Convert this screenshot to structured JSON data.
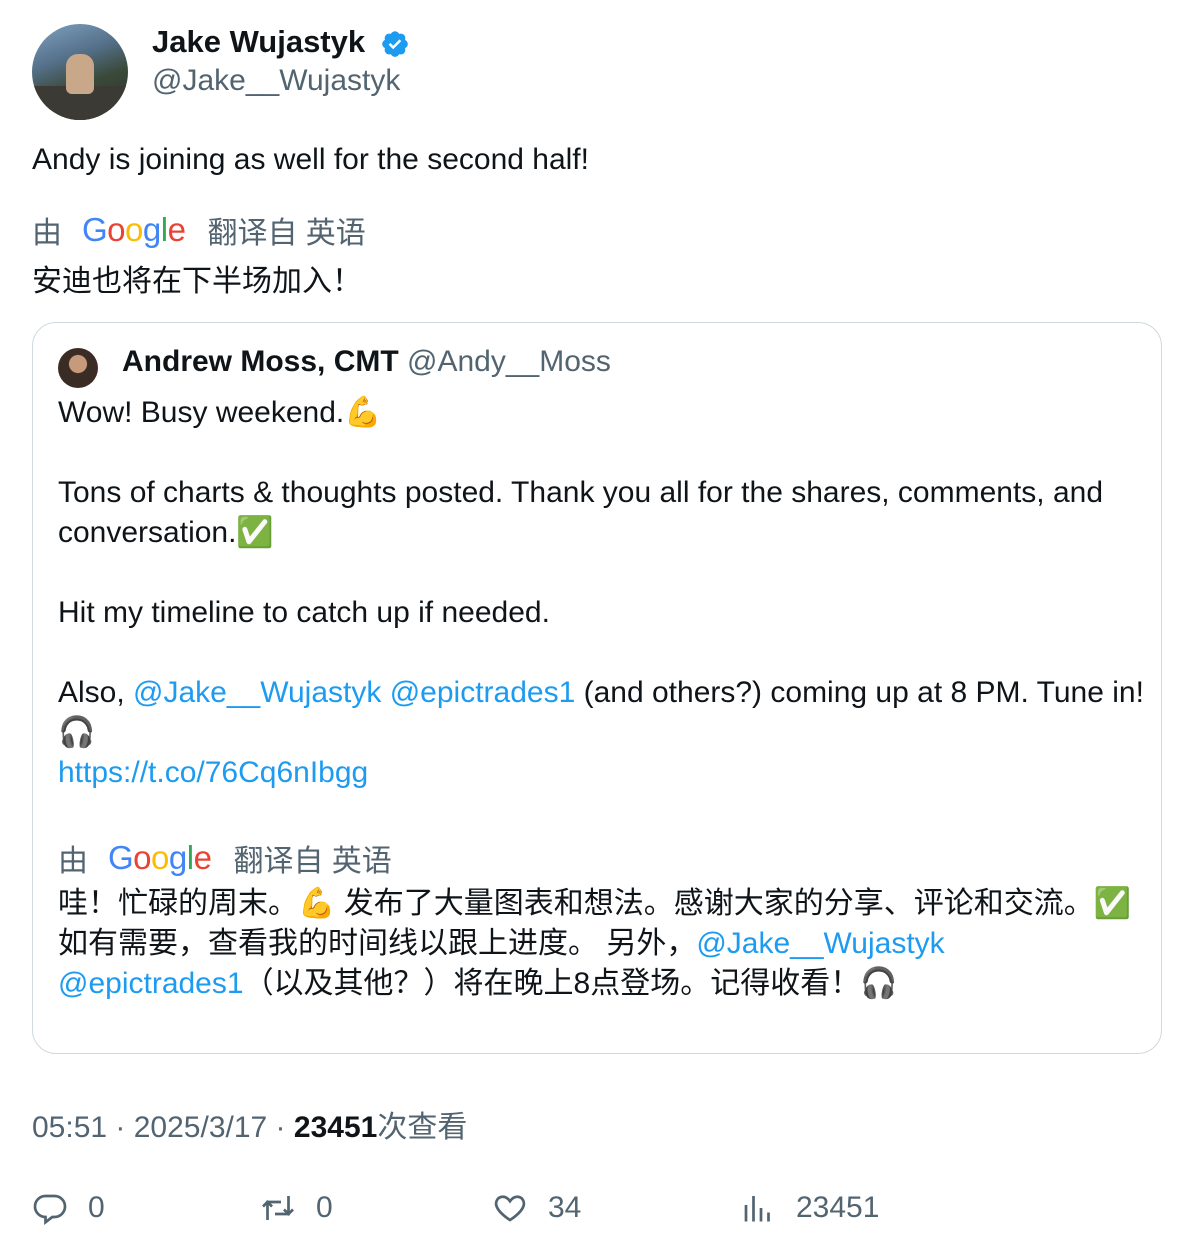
{
  "author": {
    "name": "Jake Wujastyk",
    "handle": "@Jake__Wujastyk"
  },
  "tweet_text": "Andy is joining as well for the second half!",
  "translation": {
    "by": "由",
    "translated_from": "翻译自 英语",
    "text": "安迪也将在下半场加入！"
  },
  "quoted": {
    "name": "Andrew Moss, CMT",
    "handle": "@Andy__Moss",
    "line1": "Wow! Busy weekend.💪",
    "line2": "Tons of charts & thoughts posted. Thank you all for the shares, comments, and conversation.✅",
    "line3": "Hit my timeline to catch up if needed.",
    "line4_prefix": "Also, ",
    "mention1": "@Jake__Wujastyk",
    "mention2": "@epictrades1",
    "line4_suffix": " (and others?) coming up at 8 PM. Tune in!🎧",
    "url": "https://t.co/76Cq6nIbgg",
    "translation_by": "由",
    "translation_from": "翻译自 英语",
    "translation_part1": "哇！忙碌的周末。💪 发布了大量图表和想法。感谢大家的分享、评论和交流。✅ 如有需要，查看我的时间线以跟上进度。 另外，",
    "translation_mention1": "@Jake__Wujastyk",
    "translation_mention2": "@epictrades1",
    "translation_part2": "（以及其他？）将在晚上8点登场。记得收看！🎧"
  },
  "meta": {
    "time": "05:51",
    "sep": " · ",
    "date": "2025/3/17",
    "views": "23451",
    "views_label": "次查看"
  },
  "actions": {
    "replies": "0",
    "retweets": "0",
    "likes": "34",
    "views": "23451"
  }
}
